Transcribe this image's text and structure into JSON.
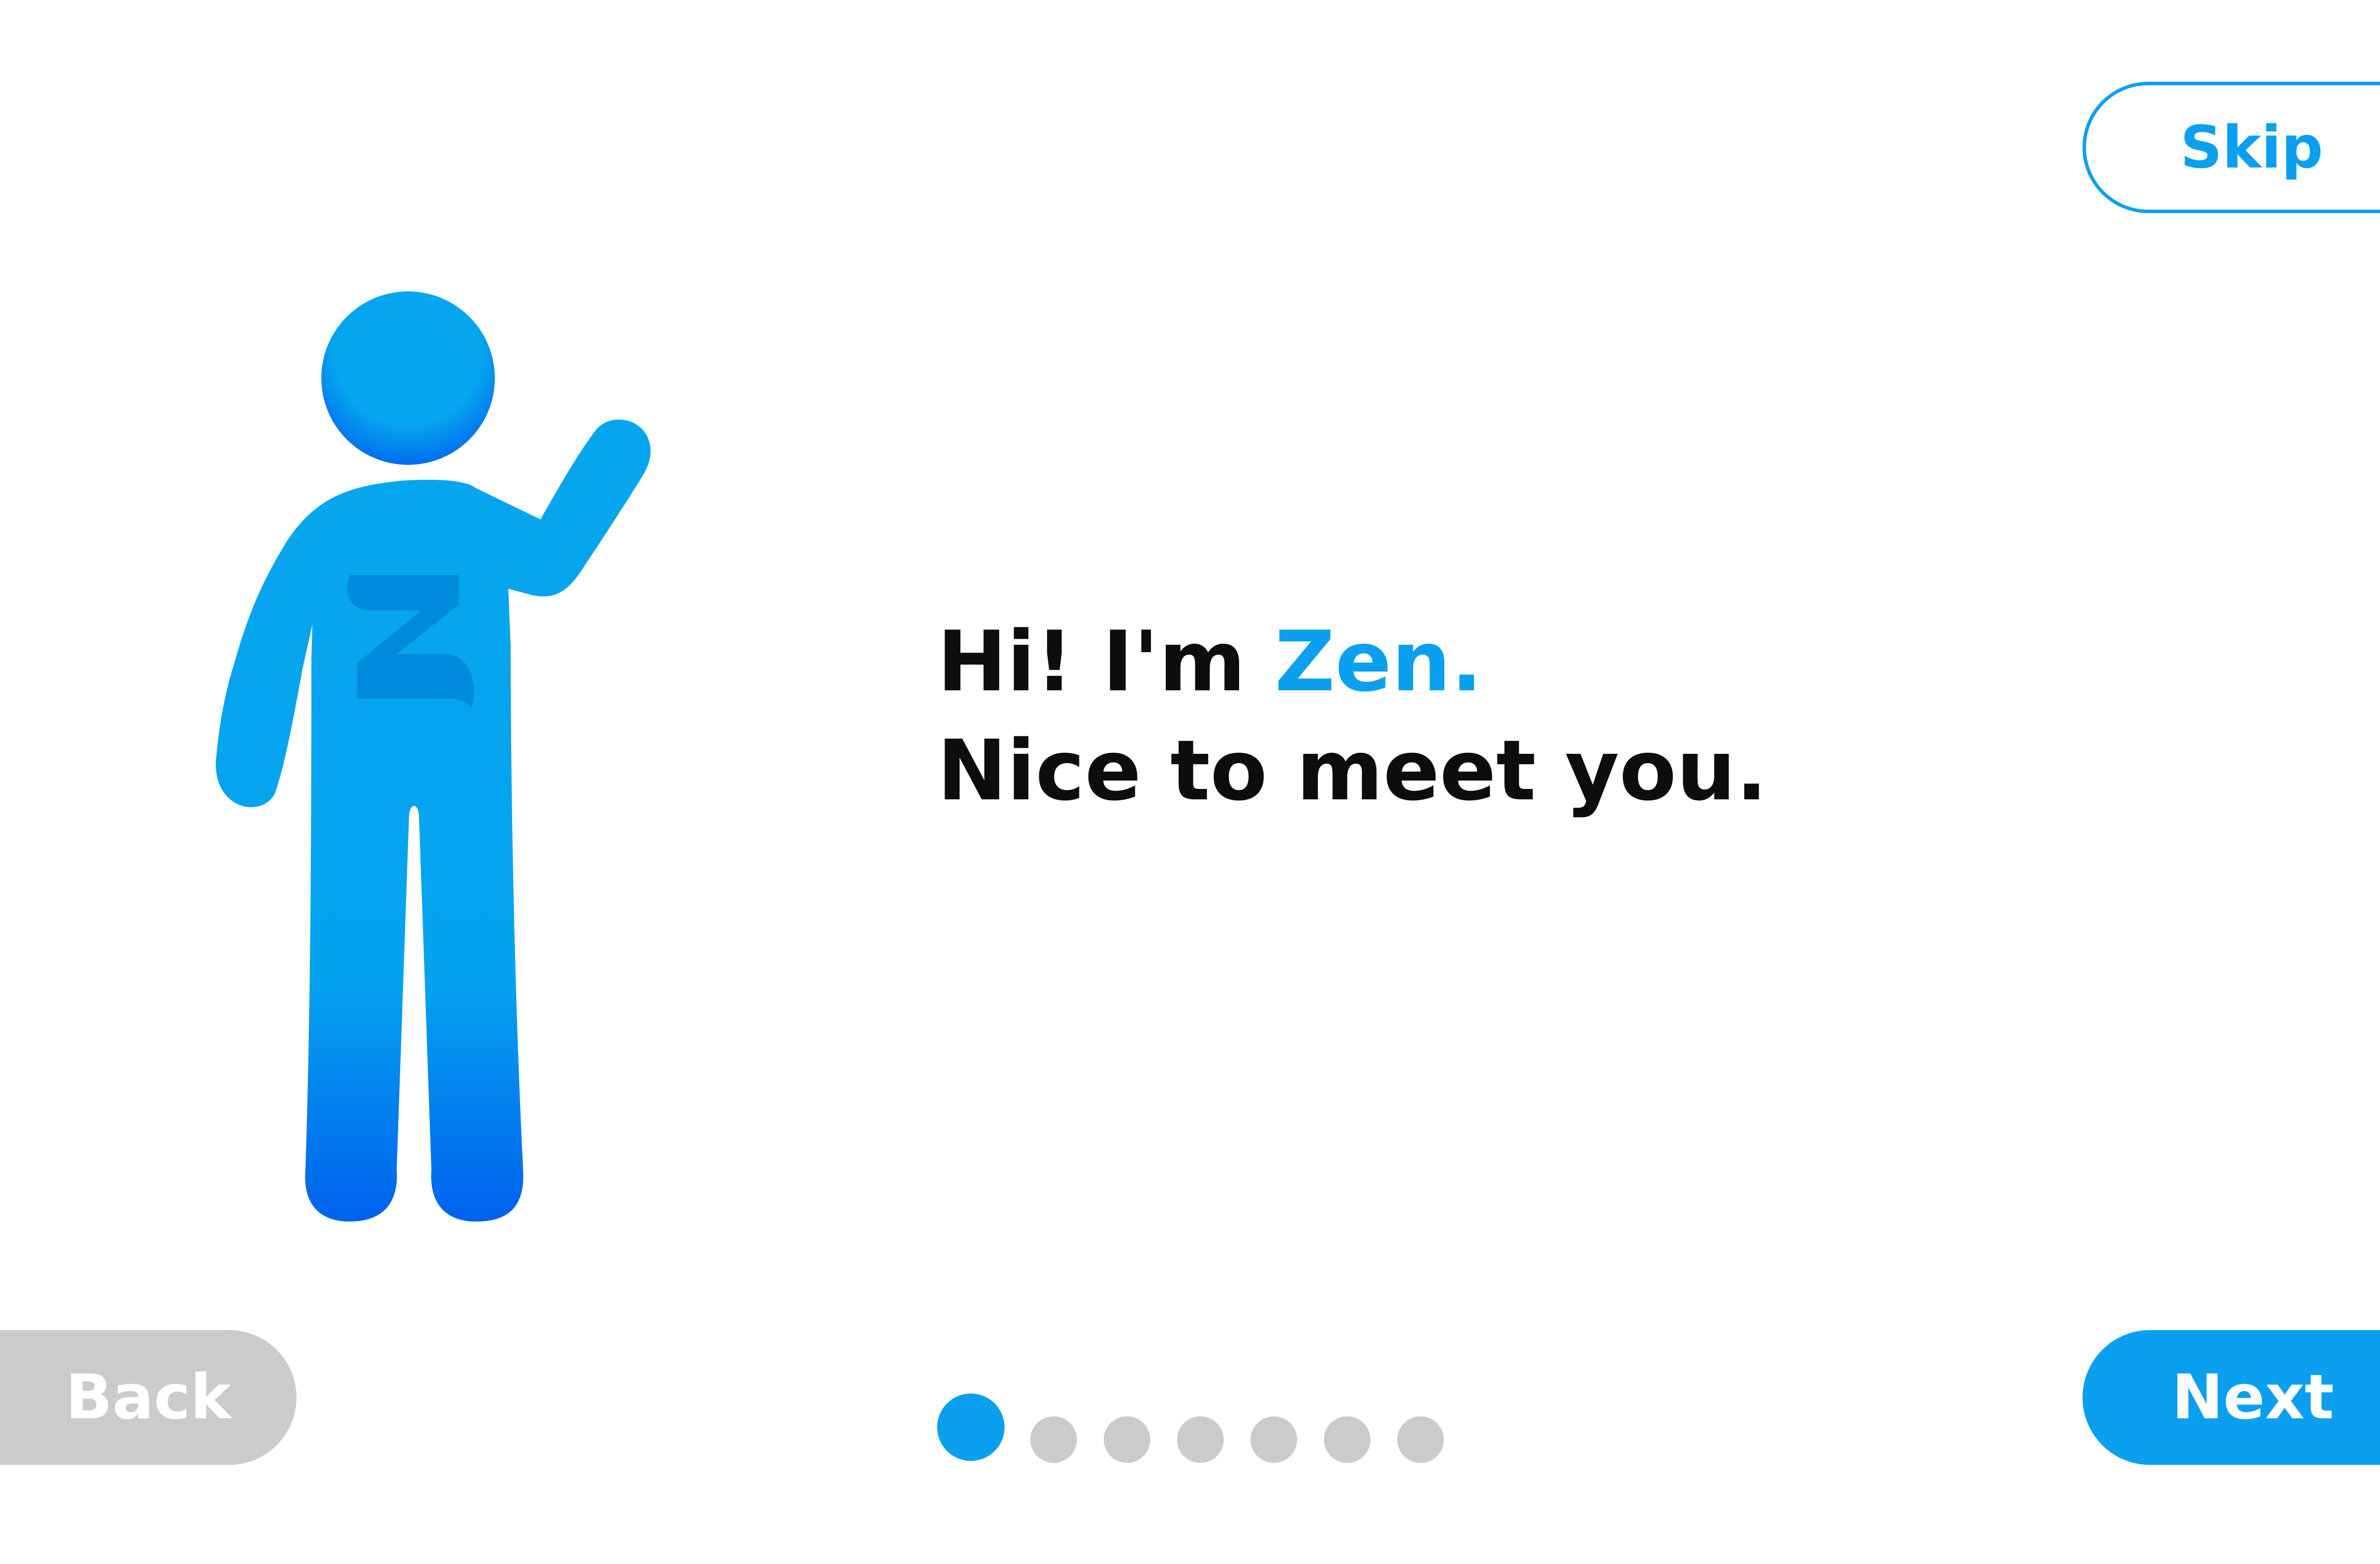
{
  "onboarding": {
    "greeting_line1_prefix": "Hi! I'm ",
    "greeting_name": "Zen.",
    "greeting_line2": "Nice to meet you.",
    "skip_label": "Skip",
    "back_label": "Back",
    "next_label": "Next",
    "mascot_icon": "waving-person-icon",
    "mascot_chest_letter": "Z"
  },
  "pagination": {
    "total_steps": 7,
    "current_step": 1
  },
  "colors": {
    "accent": "#0aa0ef",
    "mascot_gradient_top": "#06a6ee",
    "mascot_gradient_bottom": "#0061ee",
    "disabled_button": "#cbcbcb",
    "inactive_dot": "#cbcbcb",
    "text": "#0d0d0d",
    "background": "#ffffff"
  }
}
